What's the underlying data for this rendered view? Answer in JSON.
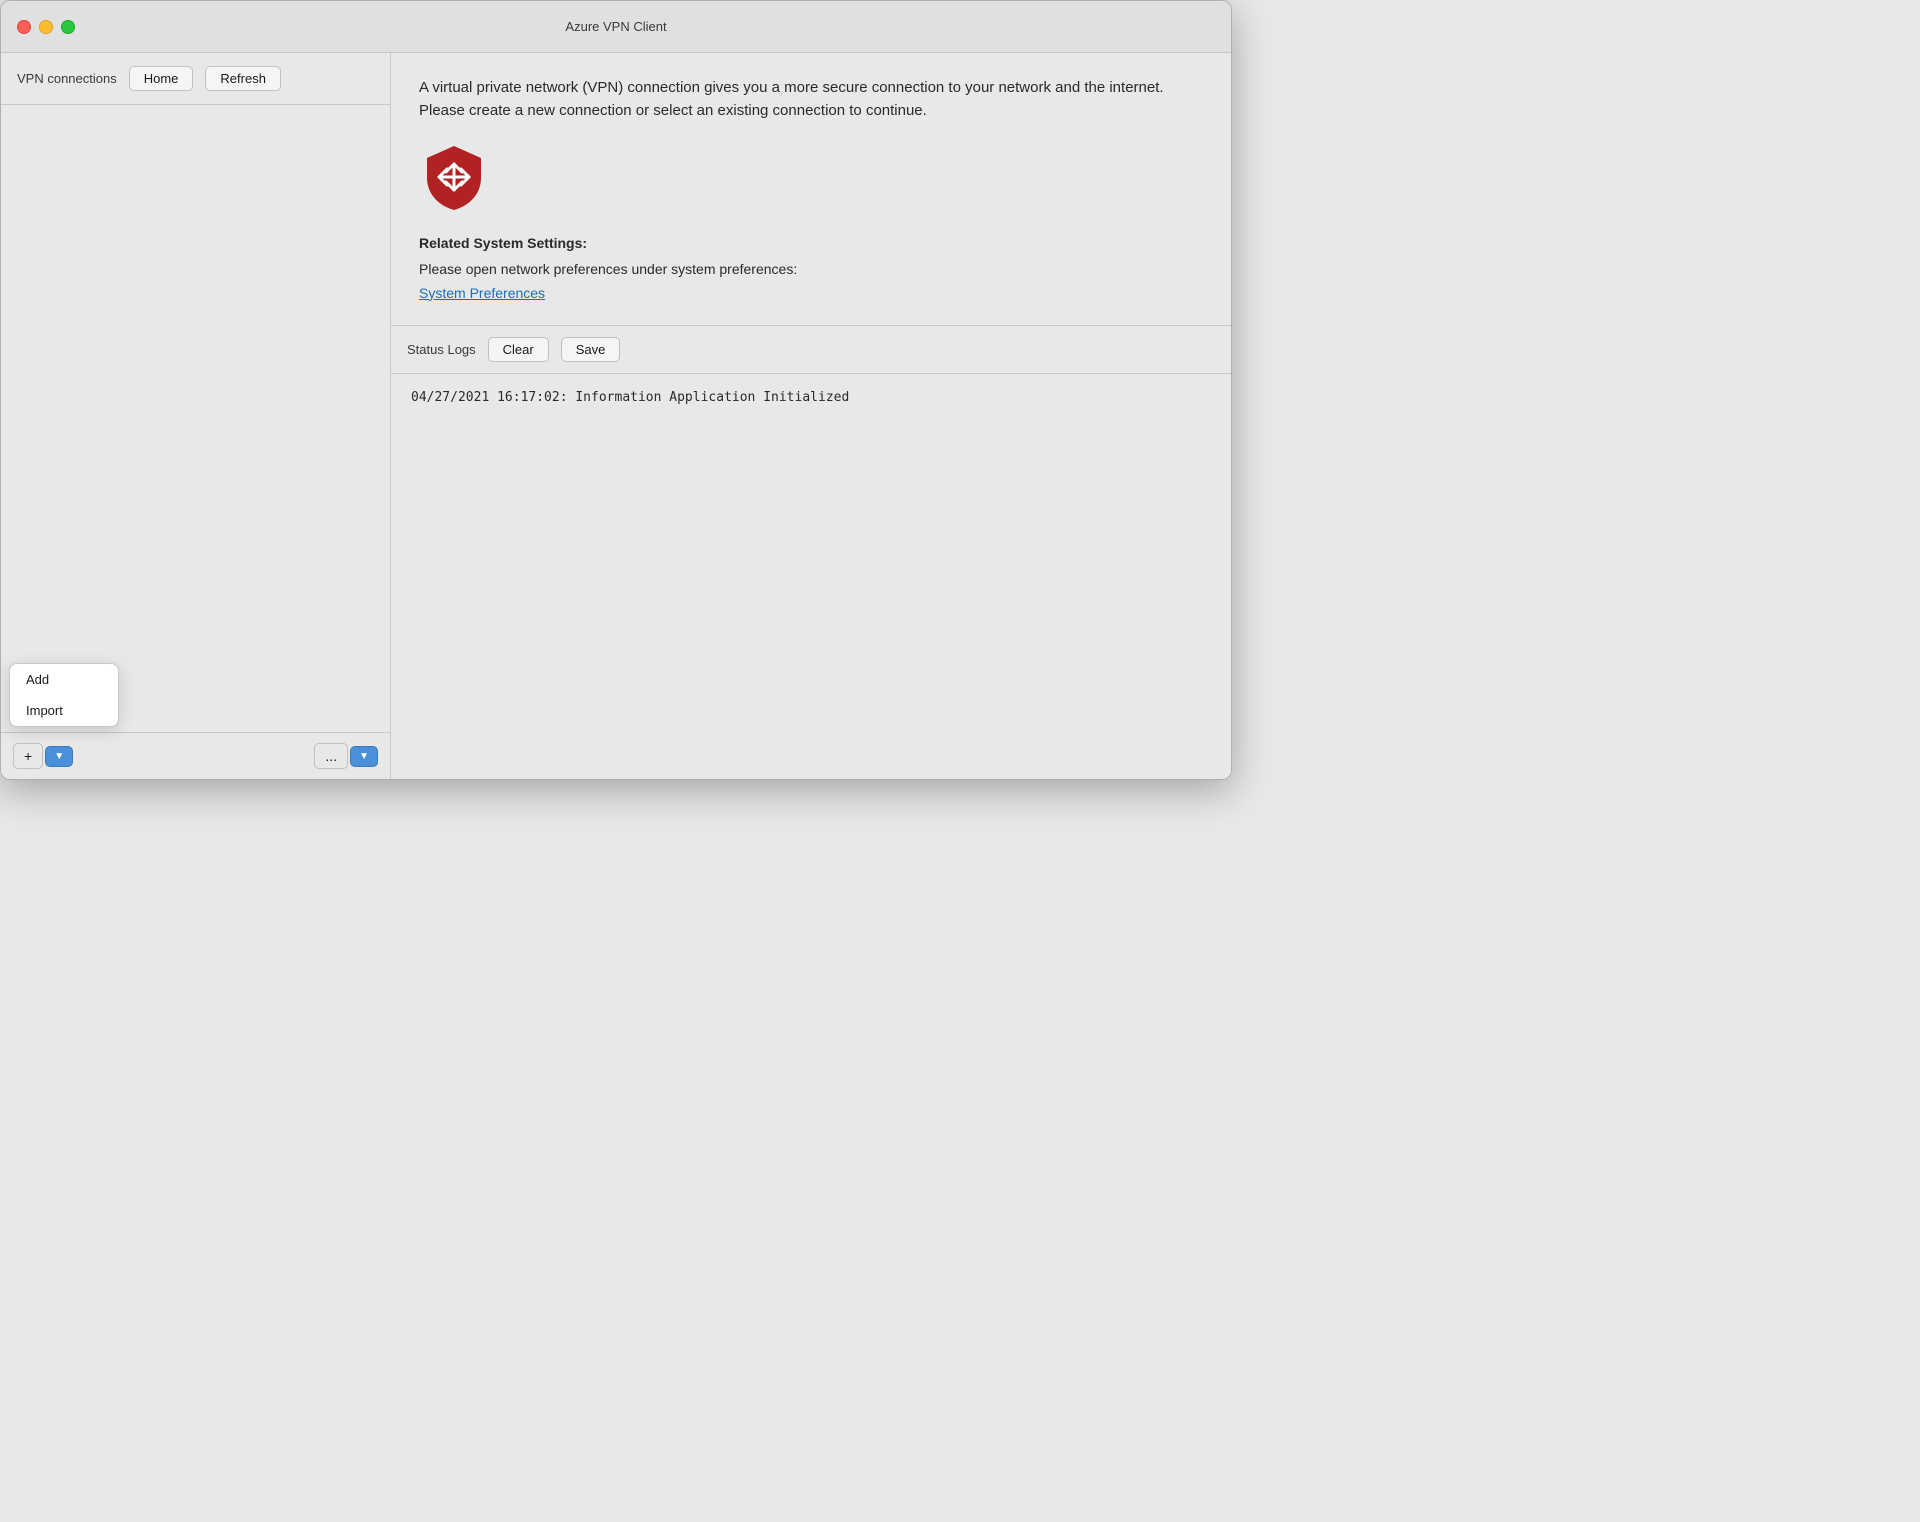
{
  "window": {
    "title": "Azure VPN Client"
  },
  "sidebar": {
    "title": "VPN connections",
    "home_button": "Home",
    "refresh_button": "Refresh",
    "add_label": "+",
    "more_label": "...",
    "dropdown": {
      "items": [
        {
          "label": "Add"
        },
        {
          "label": "Import"
        }
      ]
    }
  },
  "content": {
    "description": "A virtual private network (VPN) connection gives you a more secure connection to your network and the internet. Please create a new connection or select an existing connection to continue.",
    "related_settings_title": "Related System Settings:",
    "related_settings_text": "Please open network preferences under system preferences:",
    "system_preferences_link": "System Preferences"
  },
  "status_logs": {
    "title": "Status Logs",
    "clear_button": "Clear",
    "save_button": "Save",
    "log_entry": "04/27/2021 16:17:02: Information Application Initialized"
  },
  "colors": {
    "accent_blue": "#4a90d9",
    "link_blue": "#1a6fba",
    "shield_red": "#b22222"
  }
}
